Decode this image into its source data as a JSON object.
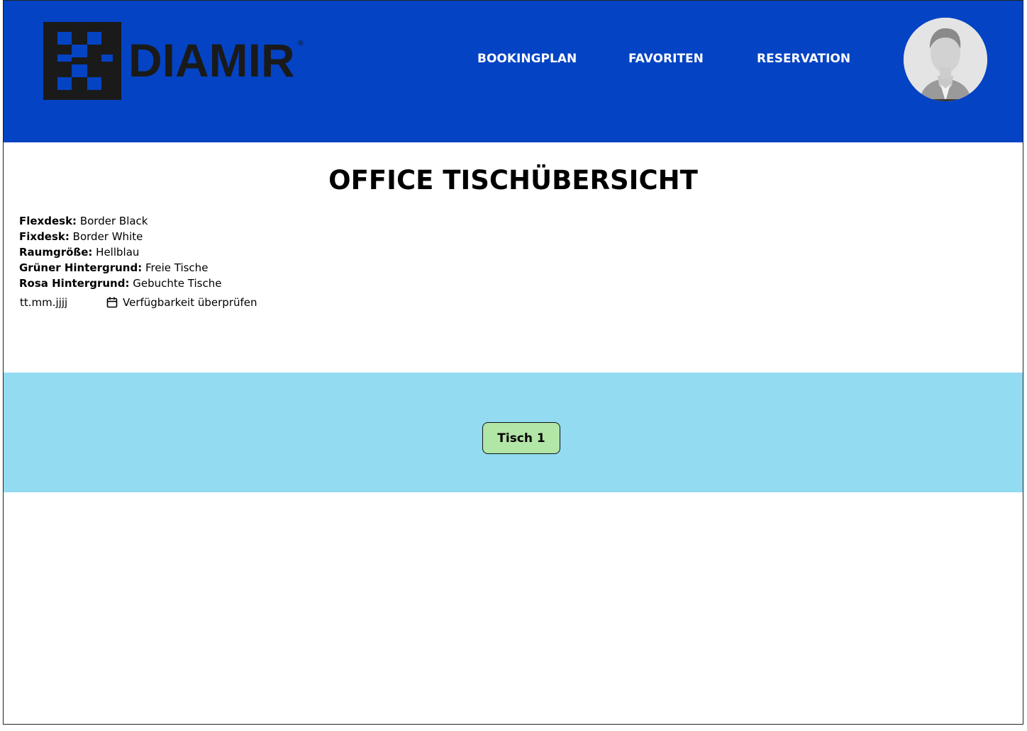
{
  "header": {
    "brand": "DIAMIR",
    "brand_mark": "®",
    "background_color": "#0443c3",
    "nav": [
      {
        "label": "BOOKINGPLAN"
      },
      {
        "label": "FAVORITEN"
      },
      {
        "label": "RESERVATION"
      }
    ],
    "avatar_icon": "user-avatar"
  },
  "main": {
    "title": "OFFICE TISCHÜBERSICHT",
    "legend": [
      {
        "key": "Flexdesk:",
        "value": "Border Black"
      },
      {
        "key": "Fixdesk:",
        "value": "Border White"
      },
      {
        "key": "Raumgröße:",
        "value": "Hellblau"
      },
      {
        "key": "Grüner Hintergrund:",
        "value": "Freie Tische"
      },
      {
        "key": "Rosa Hintergrund:",
        "value": "Gebuchte Tische"
      }
    ],
    "date_picker": {
      "placeholder": "tt.mm.jjjj",
      "value": ""
    },
    "check_button": {
      "label": "Verfügbarkeit überprüfen",
      "icon": "calendar-icon"
    }
  },
  "room": {
    "color": "#92dbf1",
    "desks": [
      {
        "label": "Tisch 1",
        "status_color": "#b2e6a7"
      }
    ]
  }
}
